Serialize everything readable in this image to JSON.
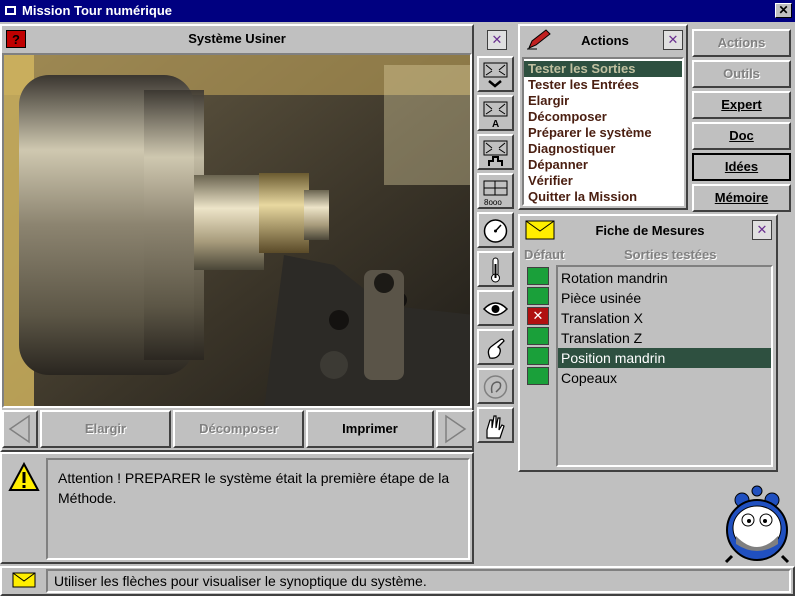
{
  "window": {
    "title": "Mission Tour numérique"
  },
  "main_panel": {
    "title": "Système  Usiner"
  },
  "nav": {
    "elargir": "Elargir",
    "decomposer": "Décomposer",
    "imprimer": "Imprimer"
  },
  "message": {
    "text": "Attention ! PREPARER le système était la première étape de la Méthode."
  },
  "status": {
    "text": "Utiliser les flèches pour visualiser le synoptique du système."
  },
  "actions": {
    "title": "Actions",
    "items": [
      {
        "label": "Tester les Sorties",
        "selected": true
      },
      {
        "label": "Tester les Entrées",
        "selected": false
      },
      {
        "label": "Elargir",
        "selected": false
      },
      {
        "label": "Décomposer",
        "selected": false
      },
      {
        "label": "Préparer le système",
        "selected": false
      },
      {
        "label": "Diagnostiquer",
        "selected": false
      },
      {
        "label": "Dépanner",
        "selected": false
      },
      {
        "label": "Vérifier",
        "selected": false
      },
      {
        "label": "Quitter la Mission",
        "selected": false
      }
    ]
  },
  "right_buttons": {
    "actions": "Actions",
    "outils": "Outils",
    "expert": "Expert",
    "doc": "Doc",
    "idees": "Idées",
    "memoire": "Mémoire"
  },
  "mesures": {
    "title": "Fiche de Mesures",
    "col_defaut": "Défaut",
    "col_sorties": "Sorties testées",
    "rows": [
      {
        "label": "Rotation mandrin",
        "status": "ok",
        "selected": false
      },
      {
        "label": "Pièce usinée",
        "status": "ok",
        "selected": false
      },
      {
        "label": "Translation X",
        "status": "defaut",
        "selected": false
      },
      {
        "label": "Translation Z",
        "status": "ok",
        "selected": false
      },
      {
        "label": "Position mandrin",
        "status": "ok",
        "selected": true
      },
      {
        "label": "Copeaux",
        "status": "ok",
        "selected": false
      }
    ]
  },
  "colors": {
    "titlebar": "#000080",
    "selection": "#2e5040",
    "ok": "#1aa03a",
    "defaut": "#b01010",
    "list_text": "#4a1e10"
  },
  "icons": [
    "close-icon",
    "help-icon",
    "zoom-down-icon",
    "zoom-a-icon",
    "zoom-signal-icon",
    "grid-icon",
    "gauge-icon",
    "thermometer-icon",
    "eye-icon",
    "hand-icon",
    "ear-icon",
    "hand-touch-icon",
    "warning-icon",
    "envelope-icon",
    "alarm-clock-icon"
  ]
}
